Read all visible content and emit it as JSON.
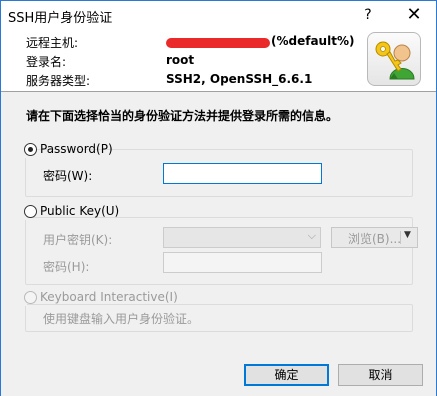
{
  "window": {
    "title": "SSH用户身份验证",
    "help_glyph": "?",
    "close_glyph": "✕"
  },
  "info": {
    "host_label": "远程主机:",
    "host_value_suffix": "(%default%)",
    "user_label": "登录名:",
    "user_value": "root",
    "server_type_label": "服务器类型:",
    "server_type_value": "SSH2, OpenSSH_6.6.1"
  },
  "instruction": "请在下面选择恰当的身份验证方法并提供登录所需的信息。",
  "methods": {
    "password": {
      "label": "Password(P)",
      "selected": true,
      "field_label": "密码(W):",
      "value": ""
    },
    "public_key": {
      "label": "Public Key(U)",
      "selected": false,
      "key_label": "用户密钥(K):",
      "key_selected": "",
      "browse_label": "浏览(B)...",
      "passphrase_label": "密码(H):",
      "passphrase_value": ""
    },
    "keyboard_interactive": {
      "label": "Keyboard Interactive(I)",
      "enabled": false,
      "hint": "使用键盘输入用户身份验证。"
    }
  },
  "buttons": {
    "ok": "确定",
    "cancel": "取消"
  },
  "colors": {
    "accent": "#0078d7",
    "window_border": "#2b79d6",
    "redaction": "#ea2a2a"
  },
  "icons": [
    "key-user-icon",
    "help-icon",
    "close-icon",
    "chevron-down-icon",
    "dropdown-arrow-icon"
  ]
}
